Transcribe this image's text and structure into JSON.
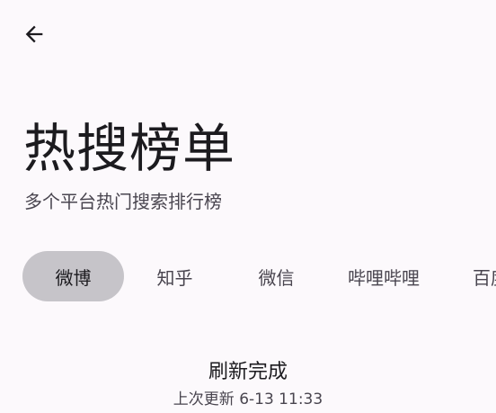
{
  "header": {
    "back_icon": "arrow-left-icon"
  },
  "page": {
    "title": "热搜榜单",
    "subtitle": "多个平台热门搜索排行榜"
  },
  "tabs": [
    {
      "label": "微博",
      "selected": true
    },
    {
      "label": "知乎",
      "selected": false
    },
    {
      "label": "微信",
      "selected": false
    },
    {
      "label": "哔哩哔哩",
      "selected": false
    },
    {
      "label": "百度",
      "selected": false
    }
  ],
  "status": {
    "message": "刷新完成",
    "last_updated": "上次更新 6-13 11:33"
  },
  "colors": {
    "background": "#fcf9fc",
    "selected_tab": "#c6c4c9",
    "text_primary": "#1c1b1f",
    "text_secondary": "#49454f"
  }
}
